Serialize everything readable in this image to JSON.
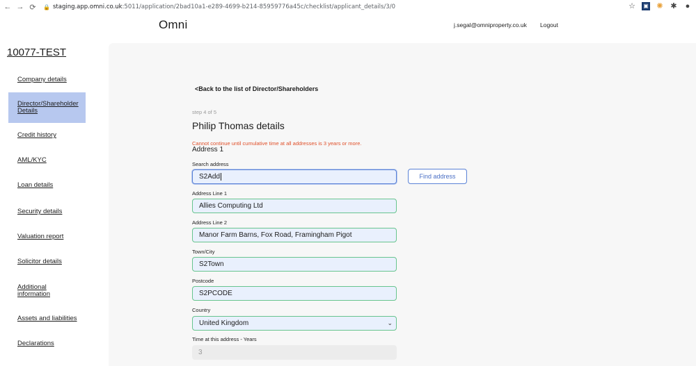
{
  "browser": {
    "url_host": "staging.app.omni.co.uk",
    "url_path": ":5011/application/2bad10a1-e289-4699-b214-85959776a45c/checklist/applicant_details/3/0"
  },
  "header": {
    "logo": "Omni",
    "user_email": "j.segal@omniproperty.co.uk",
    "logout": "Logout"
  },
  "page_title": "10077-TEST",
  "sidebar": {
    "items": [
      {
        "label": "Company details"
      },
      {
        "label": "Director/Shareholder Details",
        "active": true
      },
      {
        "label": "Credit history"
      },
      {
        "label": "AML/KYC"
      },
      {
        "label": "Loan details"
      },
      {
        "label": "Security details"
      },
      {
        "label": "Valuation report"
      },
      {
        "label": "Solicitor details"
      },
      {
        "label": "Additional information"
      },
      {
        "label": "Assets and liabilities"
      },
      {
        "label": "Declarations"
      }
    ]
  },
  "form": {
    "back_link": "<Back to the list of Director/Shareholders",
    "step": "step 4 of 5",
    "heading": "Philip Thomas details",
    "error": "Cannot continue until cumulative time at all addresses is 3 years or more.",
    "subheading": "Address 1",
    "search_address": {
      "label": "Search address",
      "value": "S2Add"
    },
    "find_button": "Find address",
    "address_line_1": {
      "label": "Address Line 1",
      "value": "Allies Computing Ltd"
    },
    "address_line_2": {
      "label": "Address Line 2",
      "value": "Manor Farm Barns, Fox Road, Framingham Pigot"
    },
    "town": {
      "label": "Town/City",
      "value": "S2Town"
    },
    "postcode": {
      "label": "Postcode",
      "value": "S2PCODE"
    },
    "country": {
      "label": "Country",
      "value": "United Kingdom"
    },
    "years": {
      "label": "Time at this address - Years",
      "value": "3"
    }
  },
  "colors": {
    "accent": "#5a82d6",
    "active_nav": "#b7c8ef",
    "valid_border": "#67c48e",
    "error": "#e0502a"
  }
}
